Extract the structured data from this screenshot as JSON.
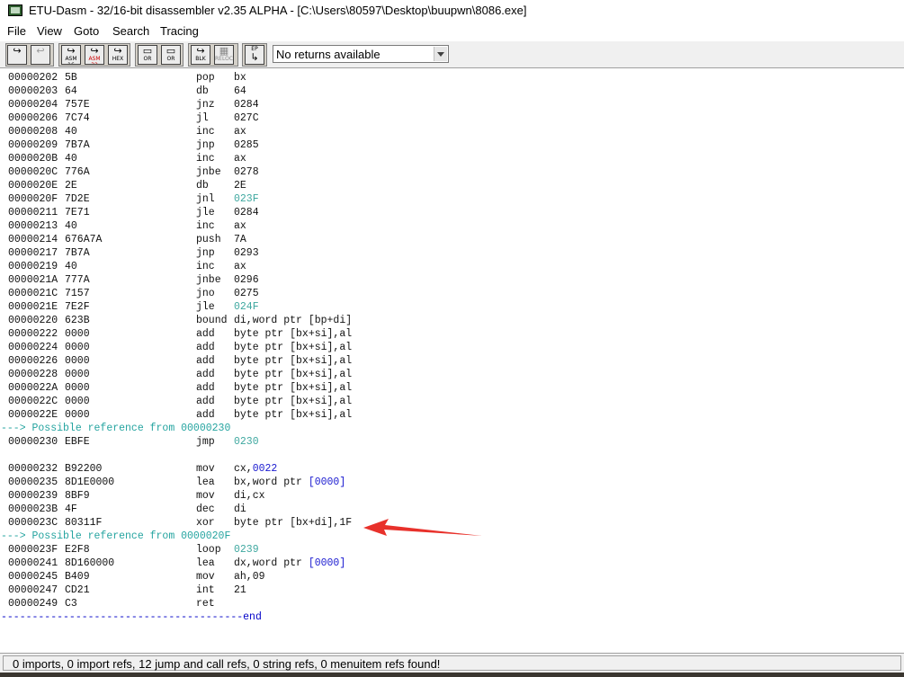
{
  "window": {
    "title": "ETU-Dasm - 32/16-bit disassembler v2.35 ALPHA - [C:\\Users\\80597\\Desktop\\buupwn\\8086.exe]"
  },
  "menu": [
    "File",
    "View",
    "Goto",
    "Search",
    "Tracing"
  ],
  "toolbar": {
    "returns_combo": "No returns available",
    "buttons": [
      {
        "name": "goto-button",
        "label": ""
      },
      {
        "name": "goto-back-button",
        "label": ""
      },
      {
        "name": "asm16-button",
        "label": "ASM 16"
      },
      {
        "name": "asm32-button",
        "label": "ASM 32"
      },
      {
        "name": "hex-button",
        "label": "HEX"
      },
      {
        "name": "or-button",
        "label": "OR"
      },
      {
        "name": "or-alt-button",
        "label": "OR"
      },
      {
        "name": "blk-button",
        "label": "BLK"
      },
      {
        "name": "reloc-button",
        "label": "RELOC"
      },
      {
        "name": "ep-button",
        "label": "EP"
      }
    ]
  },
  "listing": [
    {
      "addr": "00000202",
      "hex": "5B",
      "mn": "pop",
      "op": "bx"
    },
    {
      "addr": "00000203",
      "hex": "64",
      "mn": "db",
      "op": "64"
    },
    {
      "addr": "00000204",
      "hex": "757E",
      "mn": "jnz",
      "op": "0284"
    },
    {
      "addr": "00000206",
      "hex": "7C74",
      "mn": "jl",
      "op": "027C"
    },
    {
      "addr": "00000208",
      "hex": "40",
      "mn": "inc",
      "op": "ax"
    },
    {
      "addr": "00000209",
      "hex": "7B7A",
      "mn": "jnp",
      "op": "0285"
    },
    {
      "addr": "0000020B",
      "hex": "40",
      "mn": "inc",
      "op": "ax"
    },
    {
      "addr": "0000020C",
      "hex": "776A",
      "mn": "jnbe",
      "op": "0278"
    },
    {
      "addr": "0000020E",
      "hex": "2E",
      "mn": "db",
      "op": "2E"
    },
    {
      "addr": "0000020F",
      "hex": "7D2E",
      "mn": "jnl",
      "op": "023F",
      "kind": "ref"
    },
    {
      "addr": "00000211",
      "hex": "7E71",
      "mn": "jle",
      "op": "0284"
    },
    {
      "addr": "00000213",
      "hex": "40",
      "mn": "inc",
      "op": "ax"
    },
    {
      "addr": "00000214",
      "hex": "676A7A",
      "mn": "push",
      "op": "7A"
    },
    {
      "addr": "00000217",
      "hex": "7B7A",
      "mn": "jnp",
      "op": "0293"
    },
    {
      "addr": "00000219",
      "hex": "40",
      "mn": "inc",
      "op": "ax"
    },
    {
      "addr": "0000021A",
      "hex": "777A",
      "mn": "jnbe",
      "op": "0296"
    },
    {
      "addr": "0000021C",
      "hex": "7157",
      "mn": "jno",
      "op": "0275"
    },
    {
      "addr": "0000021E",
      "hex": "7E2F",
      "mn": "jle",
      "op": "024F",
      "kind": "ref"
    },
    {
      "addr": "00000220",
      "hex": "623B",
      "mn": "bound",
      "op": "di,word ptr [bp+di]"
    },
    {
      "addr": "00000222",
      "hex": "0000",
      "mn": "add",
      "op": "byte ptr [bx+si],al"
    },
    {
      "addr": "00000224",
      "hex": "0000",
      "mn": "add",
      "op": "byte ptr [bx+si],al"
    },
    {
      "addr": "00000226",
      "hex": "0000",
      "mn": "add",
      "op": "byte ptr [bx+si],al"
    },
    {
      "addr": "00000228",
      "hex": "0000",
      "mn": "add",
      "op": "byte ptr [bx+si],al"
    },
    {
      "addr": "0000022A",
      "hex": "0000",
      "mn": "add",
      "op": "byte ptr [bx+si],al"
    },
    {
      "addr": "0000022C",
      "hex": "0000",
      "mn": "add",
      "op": "byte ptr [bx+si],al"
    },
    {
      "addr": "0000022E",
      "hex": "0000",
      "mn": "add",
      "op": "byte ptr [bx+si],al"
    },
    {
      "xref": "---> Possible reference from 00000230"
    },
    {
      "addr": "00000230",
      "hex": "EBFE",
      "mn": "jmp",
      "op": "0230",
      "kind": "ref"
    },
    {
      "blank": true
    },
    {
      "addr": "00000232",
      "hex": "B92200",
      "mn": "mov",
      "op": "cx,",
      "op2": "0022",
      "kind": "mem"
    },
    {
      "addr": "00000235",
      "hex": "8D1E0000",
      "mn": "lea",
      "op": "bx,word ptr ",
      "op2": "[0000]",
      "kind": "mem"
    },
    {
      "addr": "00000239",
      "hex": "8BF9",
      "mn": "mov",
      "op": "di,cx"
    },
    {
      "addr": "0000023B",
      "hex": "4F",
      "mn": "dec",
      "op": "di"
    },
    {
      "addr": "0000023C",
      "hex": "80311F",
      "mn": "xor",
      "op": "byte ptr [bx+di],1F"
    },
    {
      "xref": "---> Possible reference from 0000020F"
    },
    {
      "addr": "0000023F",
      "hex": "E2F8",
      "mn": "loop",
      "op": "0239",
      "kind": "ref"
    },
    {
      "addr": "00000241",
      "hex": "8D160000",
      "mn": "lea",
      "op": "dx,word ptr ",
      "op2": "[0000]",
      "kind": "mem"
    },
    {
      "addr": "00000245",
      "hex": "B409",
      "mn": "mov",
      "op": "ah,09"
    },
    {
      "addr": "00000247",
      "hex": "CD21",
      "mn": "int",
      "op": "21"
    },
    {
      "addr": "00000249",
      "hex": "C3",
      "mn": "ret",
      "op": ""
    },
    {
      "end": "---------------------------------------end"
    }
  ],
  "status": {
    "text": "0 imports, 0 import refs, 12 jump and call refs, 0 string refs, 0 menuitem refs found!"
  },
  "colors": {
    "annotation_arrow": "#e8312b",
    "reference": "#3fa8a0",
    "memory_operand": "#1a1ad0"
  }
}
